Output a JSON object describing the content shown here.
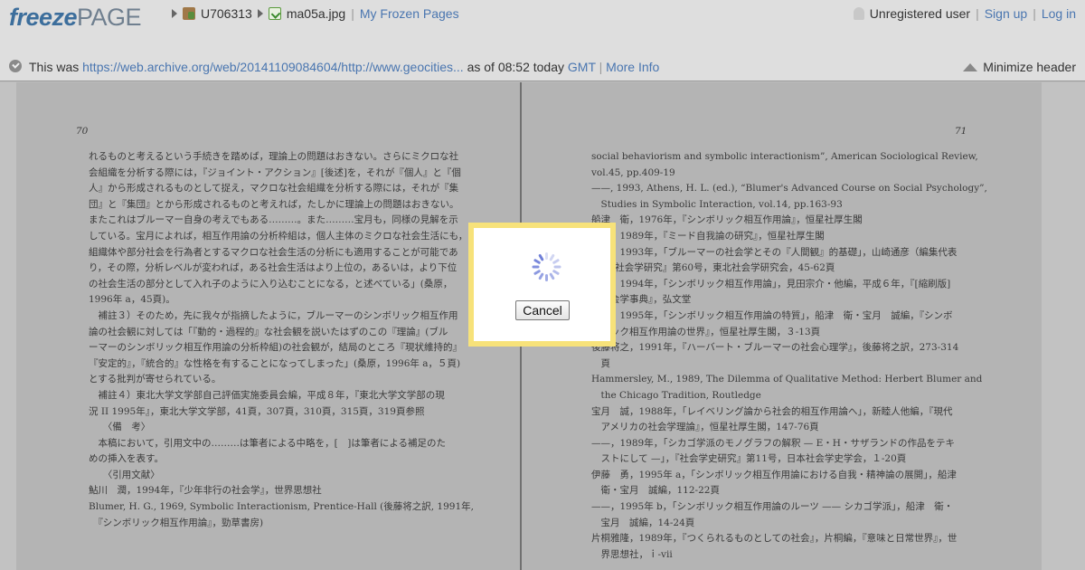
{
  "header": {
    "logo_freeze": "freeze",
    "logo_page": "PAGE",
    "breadcrumb": {
      "user_id": "U706313",
      "file_name": "ma05a.jpg",
      "my_pages": "My Frozen Pages"
    },
    "account": {
      "status": "Unregistered user",
      "sign_up": "Sign up",
      "log_in": "Log in"
    },
    "archive": {
      "prefix": "This was",
      "url": "https://web.archive.org/web/20141109084604/http://www.geocities...",
      "time_text": "as of 08:52 today",
      "timezone": "GMT",
      "more_info": "More Info",
      "minimize": "Minimize header"
    },
    "separator": "|"
  },
  "scan": {
    "left_page": {
      "page_number": "70",
      "lines": [
        "れるものと考えるという手続きを踏めば，理論上の問題はおきない。さらにミクロな社",
        "会組織を分析する際には，『ジョイント・アクション』[後述]を，それが『個人』と『個",
        "人』から形成されるものとして捉え，マクロな社会組織を分析する際には，それが『集",
        "団』と『集団』とから形成されるものと考えれば，たしかに理論上の問題はおきない。",
        "またこれはブルーマー自身の考えでもある………。また………宝月も，同様の見解を示",
        "している。宝月によれば，相互作用論の分析枠組は，個人主体のミクロな社会生活にも，",
        "組織体や部分社会を行為者とするマクロな社会生活の分析にも適用することが可能であ",
        "り，その際，分析レベルが変われば，ある社会生活はより上位の，あるいは，より下位",
        "の社会生活の部分として入れ子のように入り込むことになる，と述べている」(桑原，",
        "1996年 a，45頁)。",
        "　補註３）そのため，先に我々が指摘したように，ブルーマーのシンボリック相互作用",
        "論の社会観に対しては「『動的・過程的』な社会観を説いたはずのこの『理論』(ブル",
        "ーマーのシンボリック相互作用論の分析枠組)の社会観が，結局のところ『現状維持的』",
        "『安定的』，『統合的』な性格を有することになってしまった」(桑原，1996年 a，５頁)",
        "とする批判が寄せられている。",
        "　補註４）東北大学文学部自己評価実施委員会編，平成８年，『東北大学文学部の現",
        "況 II 1995年』，東北大学文学部，41頁，307頁，310頁，315頁，319頁参照",
        "　　〈備　考〉",
        "　本稿において，引用文中の………は筆者による中略を，[　]は筆者による補足のた",
        "めの挿入を表す。",
        "　　〈引用文献〉",
        "鮎川　潤，1994年，『少年非行の社会学』，世界思想社",
        "Blumer, H. G., 1969, Symbolic Interactionism, Prentice-Hall (後藤将之訳, 1991年,",
        "　『シンボリック相互作用論』，勁草書房)"
      ]
    },
    "right_page": {
      "page_number": "71",
      "lines": [
        "social behaviorism and symbolic interactionism”, American Sociological Review,",
        "vol.45, pp.409-19",
        "——, 1993, Athens, H. L. (ed.), “Blumer's Advanced Course on Social Psychology”,",
        "　Studies in Symbolic Interaction, vol.14, pp.163-93",
        "船津　衛，1976年，『シンボリック相互作用論』，恒星社厚生閣",
        "——，1989年，『ミード自我論の研究』，恒星社厚生閣",
        "——，1993年，「ブルーマーの社会学とその『人間観』的基礎」，山崎通彦（編集代表",
        "　）『社会学研究』第60号，東北社会学研究会，45-62頁",
        "——，1994年，「シンボリック相互作用論」，見田宗介・他編，平成６年，『[縮刷版]",
        "　社会学事典』，弘文堂",
        "——，1995年，「シンボリック相互作用論の特質」，船津　衛・宝月　誠編，『シンボ",
        "　リック相互作用論の世界』，恒星社厚生閣，３-13頁",
        "後藤将之，1991年，『ハーバート・ブルーマーの社会心理学』，後藤将之訳，273-314",
        "　頁",
        "Hammersley, M., 1989, The Dilemma of Qualitative Method: Herbert Blumer and",
        "　the Chicago Tradition, Routledge",
        "宝月　誠，1988年，「レイベリング論から社会的相互作用論へ」，新睦人他編，『現代",
        "　アメリカの社会学理論』，恒星社厚生閣，147-76頁",
        "——，1989年，「シカゴ学派のモノグラフの解釈 — E・H・サザランドの作品をテキ",
        "　ストにして —」，『社会学史研究』第11号，日本社会学史学会，１-20頁",
        "伊藤　勇，1995年 a，「シンボリック相互作用論における自我・精神論の展開」，船津",
        "　衛・宝月　誠編，112-22頁",
        "——，1995年 b，「シンボリック相互作用論のルーツ —— シカゴ学派」，船津　衛・",
        "　宝月　誠編，14-24頁",
        "片桐雅隆，1989年，『つくられるものとしての社会』，片桐編，『意味と日常世界』，世",
        "　界思想社，ｉ-vii"
      ]
    }
  },
  "modal": {
    "cancel_label": "Cancel"
  }
}
